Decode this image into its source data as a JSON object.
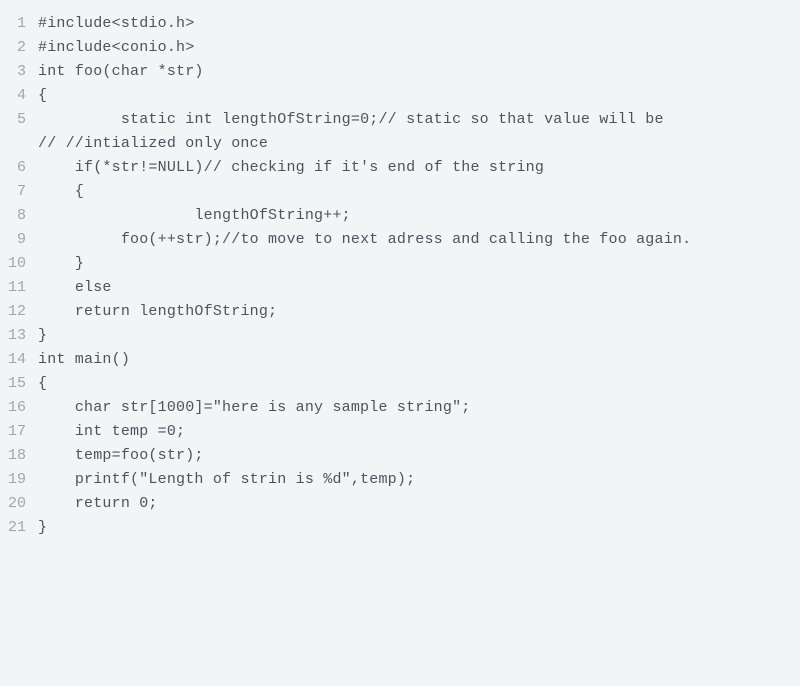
{
  "lines": [
    {
      "no": "1",
      "code": "#include<stdio.h>"
    },
    {
      "no": "2",
      "code": "#include<conio.h>"
    },
    {
      "no": "3",
      "code": "int foo(char *str)"
    },
    {
      "no": "4",
      "code": "{"
    },
    {
      "no": "5",
      "code": "         static int lengthOfString=0;// static so that value will be                                       // //intialized only once"
    },
    {
      "no": "6",
      "code": "    if(*str!=NULL)// checking if it's end of the string"
    },
    {
      "no": "7",
      "code": "    {"
    },
    {
      "no": "8",
      "code": "                 lengthOfString++;"
    },
    {
      "no": "9",
      "code": "         foo(++str);//to move to next adress and calling the foo again."
    },
    {
      "no": "10",
      "code": "    }"
    },
    {
      "no": "11",
      "code": "    else"
    },
    {
      "no": "12",
      "code": "    return lengthOfString;"
    },
    {
      "no": "13",
      "code": "}"
    },
    {
      "no": "14",
      "code": "int main()"
    },
    {
      "no": "15",
      "code": "{"
    },
    {
      "no": "16",
      "code": "    char str[1000]=\"here is any sample string\";"
    },
    {
      "no": "17",
      "code": "    int temp =0;"
    },
    {
      "no": "18",
      "code": "    temp=foo(str);"
    },
    {
      "no": "19",
      "code": "    printf(\"Length of strin is %d\",temp);"
    },
    {
      "no": "20",
      "code": "    return 0;"
    },
    {
      "no": "21",
      "code": "}"
    }
  ]
}
